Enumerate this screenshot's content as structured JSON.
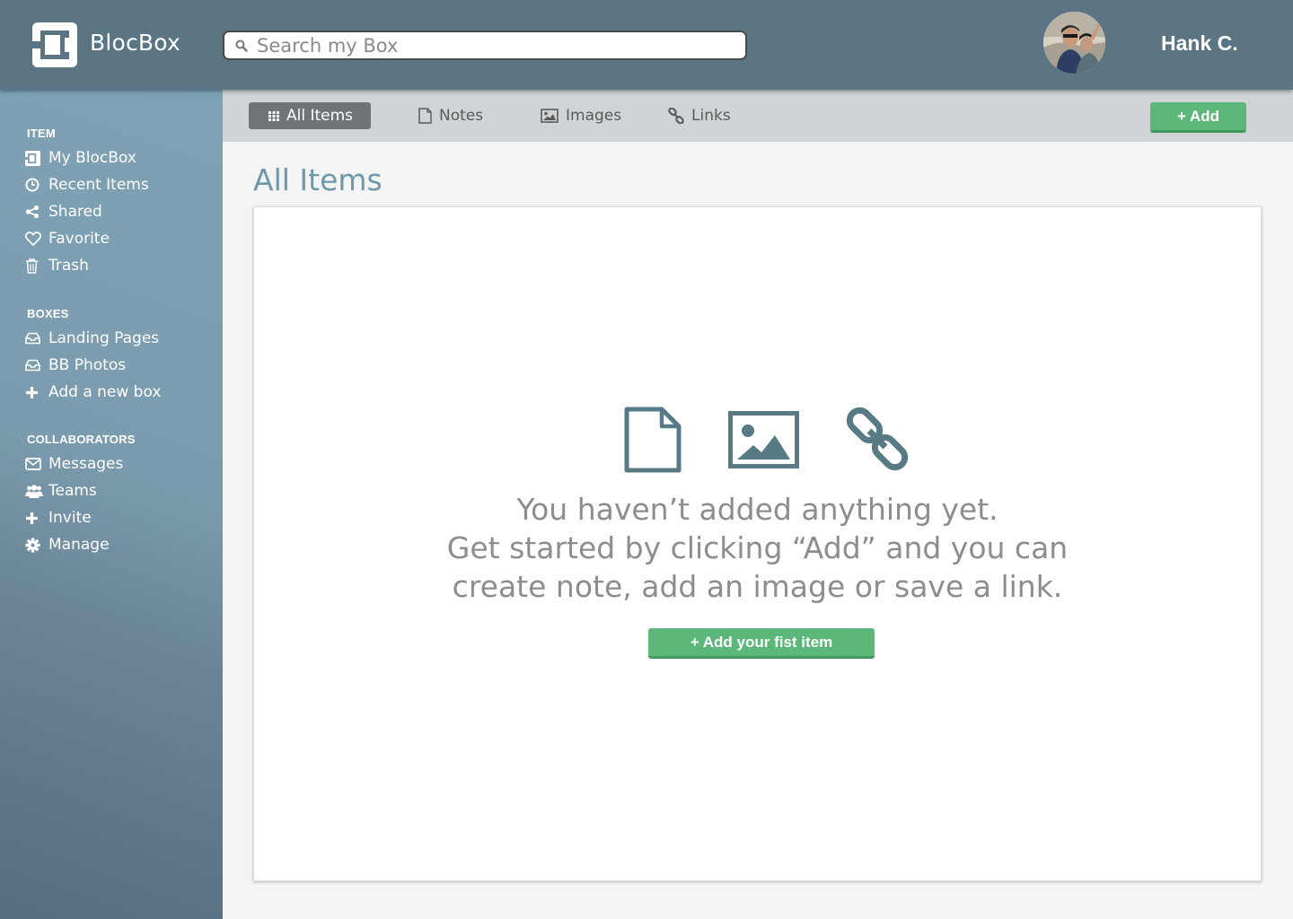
{
  "header": {
    "brand": "BlocBox",
    "search_placeholder": "Search my Box",
    "username": "Hank C."
  },
  "sidebar": {
    "sections": [
      {
        "title": "ITEM",
        "items": [
          {
            "label": "My BlocBox",
            "icon": "blocbox-icon"
          },
          {
            "label": "Recent Items",
            "icon": "clock-icon"
          },
          {
            "label": "Shared",
            "icon": "share-icon"
          },
          {
            "label": "Favorite",
            "icon": "heart-icon"
          },
          {
            "label": "Trash",
            "icon": "trash-icon"
          }
        ]
      },
      {
        "title": "BOXES",
        "items": [
          {
            "label": "Landing Pages",
            "icon": "inbox-icon"
          },
          {
            "label": "BB Photos",
            "icon": "inbox-icon"
          },
          {
            "label": "Add a new box",
            "icon": "plus-icon"
          }
        ]
      },
      {
        "title": "COLLABORATORS",
        "items": [
          {
            "label": "Messages",
            "icon": "envelope-icon"
          },
          {
            "label": "Teams",
            "icon": "users-icon"
          },
          {
            "label": "Invite",
            "icon": "plus-icon"
          },
          {
            "label": "Manage",
            "icon": "gear-icon"
          }
        ]
      }
    ]
  },
  "toolbar": {
    "tabs": [
      {
        "label": "All Items",
        "icon": "grid-icon",
        "active": true
      },
      {
        "label": "Notes",
        "icon": "file-icon"
      },
      {
        "label": "Images",
        "icon": "image-icon"
      },
      {
        "label": "Links",
        "icon": "link-icon"
      }
    ],
    "add_label": "+ Add"
  },
  "main": {
    "title": "All Items",
    "empty_lines": [
      "You haven’t added anything yet.",
      "Get started by clicking “Add” and you can",
      "create note, add an image or save a link."
    ],
    "empty_button": "+ Add your fist item"
  },
  "colors": {
    "header": "#5b7585",
    "accent_green": "#5cb87a",
    "title_blue": "#6f98a8",
    "icon_slate": "#587a85"
  }
}
